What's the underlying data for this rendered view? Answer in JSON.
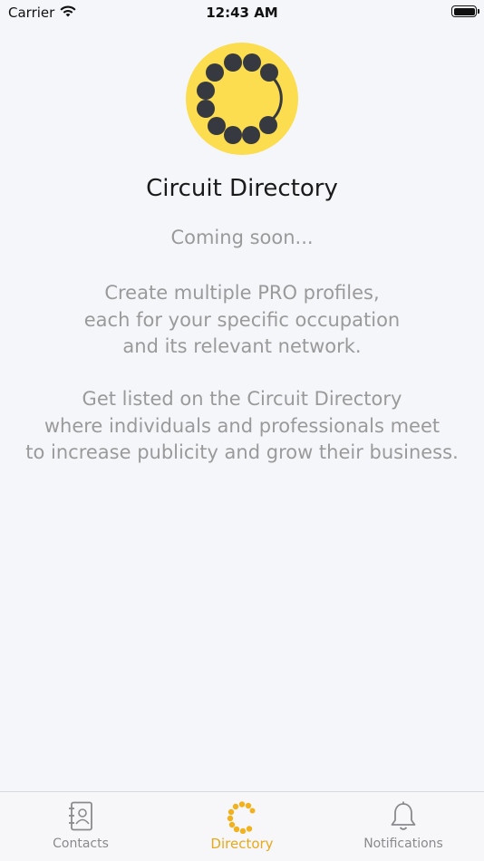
{
  "status_bar": {
    "carrier": "Carrier",
    "time": "12:43 AM"
  },
  "logo": {
    "icon": "circuit-logo",
    "background": "#fbdd4f",
    "dot_color": "#36393f"
  },
  "main": {
    "title": "Circuit Directory",
    "subtitle": "Coming soon...",
    "paragraph1": [
      "Create multiple PRO profiles,",
      "each for your specific occupation",
      "and its relevant network."
    ],
    "paragraph2": [
      "Get listed on the Circuit Directory",
      "where individuals and professionals meet",
      "to increase publicity and grow their business."
    ]
  },
  "tab_bar": {
    "active_color": "#e6a91c",
    "inactive_color": "#8a8a8e",
    "tabs": [
      {
        "label": "Contacts",
        "icon": "contacts-icon",
        "active": false
      },
      {
        "label": "Directory",
        "icon": "directory-icon",
        "active": true
      },
      {
        "label": "Notifications",
        "icon": "bell-icon",
        "active": false
      }
    ]
  }
}
